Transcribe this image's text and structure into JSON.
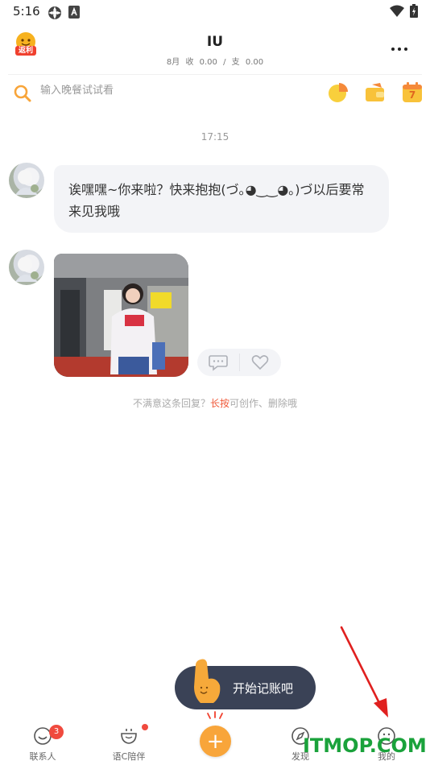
{
  "status_bar": {
    "time": "5:16",
    "icons": [
      "settings-gear-icon",
      "accessibility-a-icon",
      "wifi-icon",
      "battery-charging-icon"
    ]
  },
  "header": {
    "badge_text": "返利",
    "title": "IU",
    "month_label": "8月",
    "income_label": "收",
    "income_value": "0.00",
    "expense_label": "支",
    "expense_value": "0.00",
    "more_icon": "more-dots-icon"
  },
  "search": {
    "placeholder": "输入晚餐试试看",
    "tools": [
      "pie-chart-icon",
      "wallet-icon",
      "calendar-icon"
    ],
    "calendar_day": "7"
  },
  "chat": {
    "time": "17:15",
    "message_text": "诶嘿嘿~你来啦？快来抱抱(づ｡◕‿‿◕｡)づ以后要常来见我哦",
    "reply_actions": [
      "comment-icon",
      "heart-icon"
    ],
    "hint_prefix": "不满意这条回复？",
    "hint_highlight": "长按",
    "hint_suffix": "可创作、删除哦"
  },
  "tooltip": {
    "text": "开始记账吧"
  },
  "tabbar": {
    "items": [
      {
        "label": "联系人",
        "icon": "contacts-smile-icon",
        "badge": "3"
      },
      {
        "label": "语C陪伴",
        "icon": "companion-cup-icon"
      },
      {
        "label": "",
        "icon": "add-plus-icon"
      },
      {
        "label": "发现",
        "icon": "compass-icon"
      },
      {
        "label": "我的",
        "icon": "profile-face-icon"
      }
    ]
  },
  "watermark": "ITMOP.COM",
  "colors": {
    "accent_orange": "#f8a53a",
    "highlight_red": "#f05a3a",
    "badge_red": "#f04a3e",
    "tooltip_bg": "#3a4256",
    "bubble_bg": "#f3f4f7",
    "watermark_green": "#1aa23b",
    "arrow_red": "#e0201f"
  }
}
